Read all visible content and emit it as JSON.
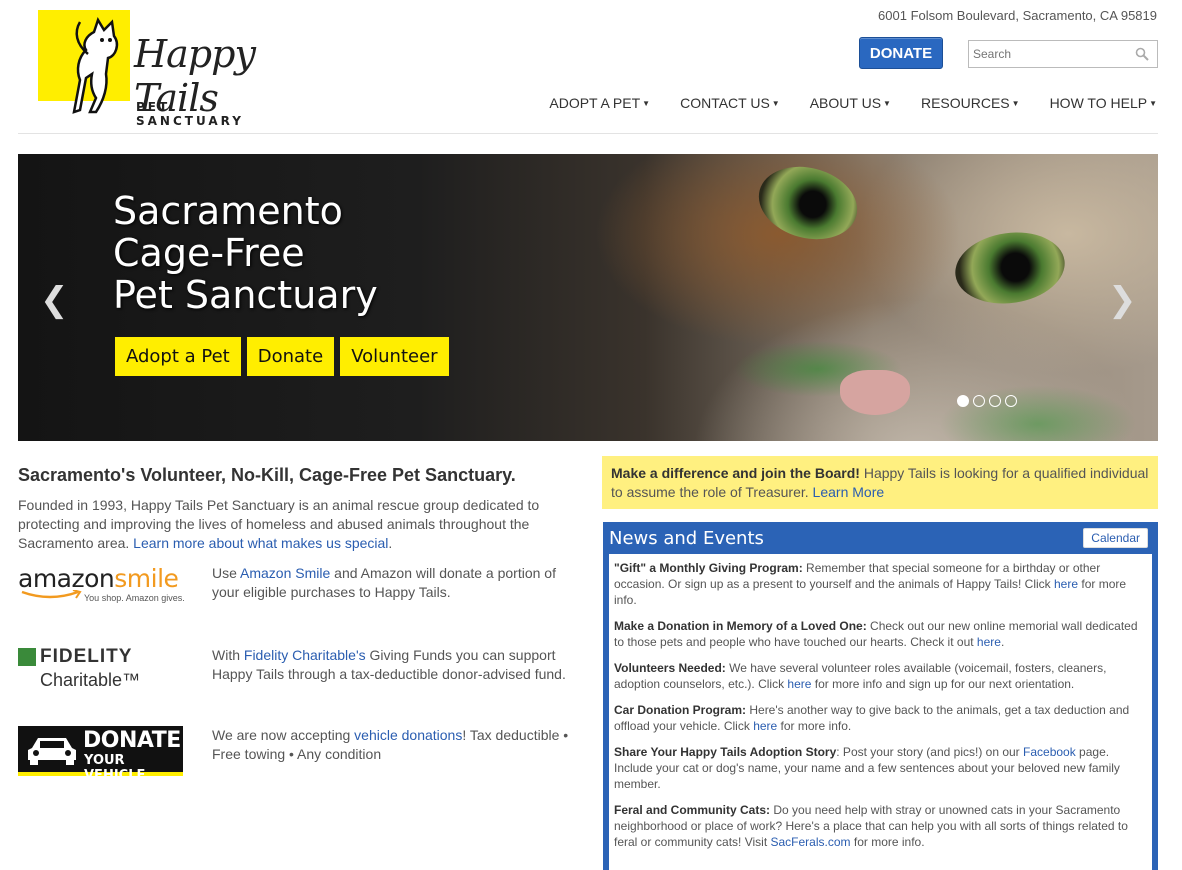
{
  "header": {
    "logo_title": "Happy Tails",
    "logo_subtitle": "PET SANCTUARY",
    "address": "6001 Folsom Boulevard, Sacramento, CA 95819",
    "donate_label": "DONATE",
    "search_placeholder": "Search"
  },
  "nav": [
    {
      "label": "ADOPT A PET"
    },
    {
      "label": "CONTACT US"
    },
    {
      "label": "ABOUT US"
    },
    {
      "label": "RESOURCES"
    },
    {
      "label": "HOW TO HELP"
    }
  ],
  "hero": {
    "title_lines": [
      "Sacramento",
      "Cage-Free",
      "Pet Sanctuary"
    ],
    "buttons": [
      "Adopt a Pet",
      "Donate",
      "Volunteer"
    ],
    "prev_glyph": "❮",
    "next_glyph": "❯",
    "slides": 4,
    "active_slide": 1
  },
  "intro": {
    "title": "Sacramento's Volunteer, No-Kill, Cage-Free Pet Sanctuary.",
    "text": "Founded in 1993, Happy Tails Pet Sanctuary is an animal rescue group dedicated to protecting and improving the lives of homeless and abused animals throughout the Sacramento area. ",
    "link": "Learn more about what makes us special",
    "link_suffix": "."
  },
  "promos": {
    "amazon": {
      "logo_word": "amazon",
      "logo_smile": "smile",
      "logo_tag": "You shop. Amazon gives.",
      "pre": "Use ",
      "link": "Amazon Smile",
      "post": " and Amazon will donate a portion of your eligible purchases to Happy Tails."
    },
    "fidelity": {
      "logo_line1": "FIDELITY",
      "logo_line2": "Charitable™",
      "pre": "With ",
      "link": "Fidelity Charitable's",
      "post": " Giving Funds you can support Happy Tails through a tax-deductible donor-advised fund."
    },
    "vehicle": {
      "logo_line1": "DONATE",
      "logo_line2": "YOUR VEHICLE",
      "pre": "We are now accepting ",
      "link": "vehicle donations",
      "post": "! Tax deductible • Free towing • Any condition"
    }
  },
  "board": {
    "bold": "Make a difference and join the Board!",
    "text": " Happy Tails is looking for a qualified individual to assume the role of Treasurer. ",
    "link": "Learn More"
  },
  "news": {
    "title": "News and Events",
    "calendar_label": "Calendar",
    "items": [
      {
        "bold": "\"Gift\" a Monthly Giving Program:",
        "text": " Remember that special someone for a birthday or other occasion.  Or sign up as a present to yourself and the animals of Happy Tails! Click ",
        "link": "here",
        "after": " for more info."
      },
      {
        "bold": "Make a Donation in Memory of a Loved One:",
        "text": " Check out our new online memorial wall dedicated to those pets and people who have touched our hearts. Check it out ",
        "link": "here",
        "after": "."
      },
      {
        "bold": "Volunteers Needed:",
        "text": " We have several volunteer roles available (voicemail, fosters, cleaners, adoption counselors, etc.). Click ",
        "link": "here",
        "after": " for more info and sign up for our next orientation."
      },
      {
        "bold": "Car Donation Program:",
        "text": " Here's another way to give back to the animals, get a tax deduction and offload your vehicle. Click ",
        "link": "here",
        "after": " for more info."
      },
      {
        "bold": "Share Your Happy Tails Adoption Story",
        "text": ": Post your story (and pics!) on our ",
        "link": "Facebook",
        "after": " page. Include your cat or dog's name, your name and a few sentences about your beloved new family member."
      },
      {
        "bold": "Feral and Community Cats:",
        "text": " Do you need help with stray or unowned cats in your Sacramento neighborhood or place of work? Here's a place that can help you with all sorts of things related to feral or community cats! Visit ",
        "link": "SacFerals.com",
        "after": " for more info."
      }
    ]
  },
  "colors": {
    "brand_yellow": "#ffee00",
    "primary_blue": "#2a68c0",
    "news_blue": "#2b63b6",
    "board_yellow": "#fff080",
    "link_blue": "#2a5db0"
  }
}
